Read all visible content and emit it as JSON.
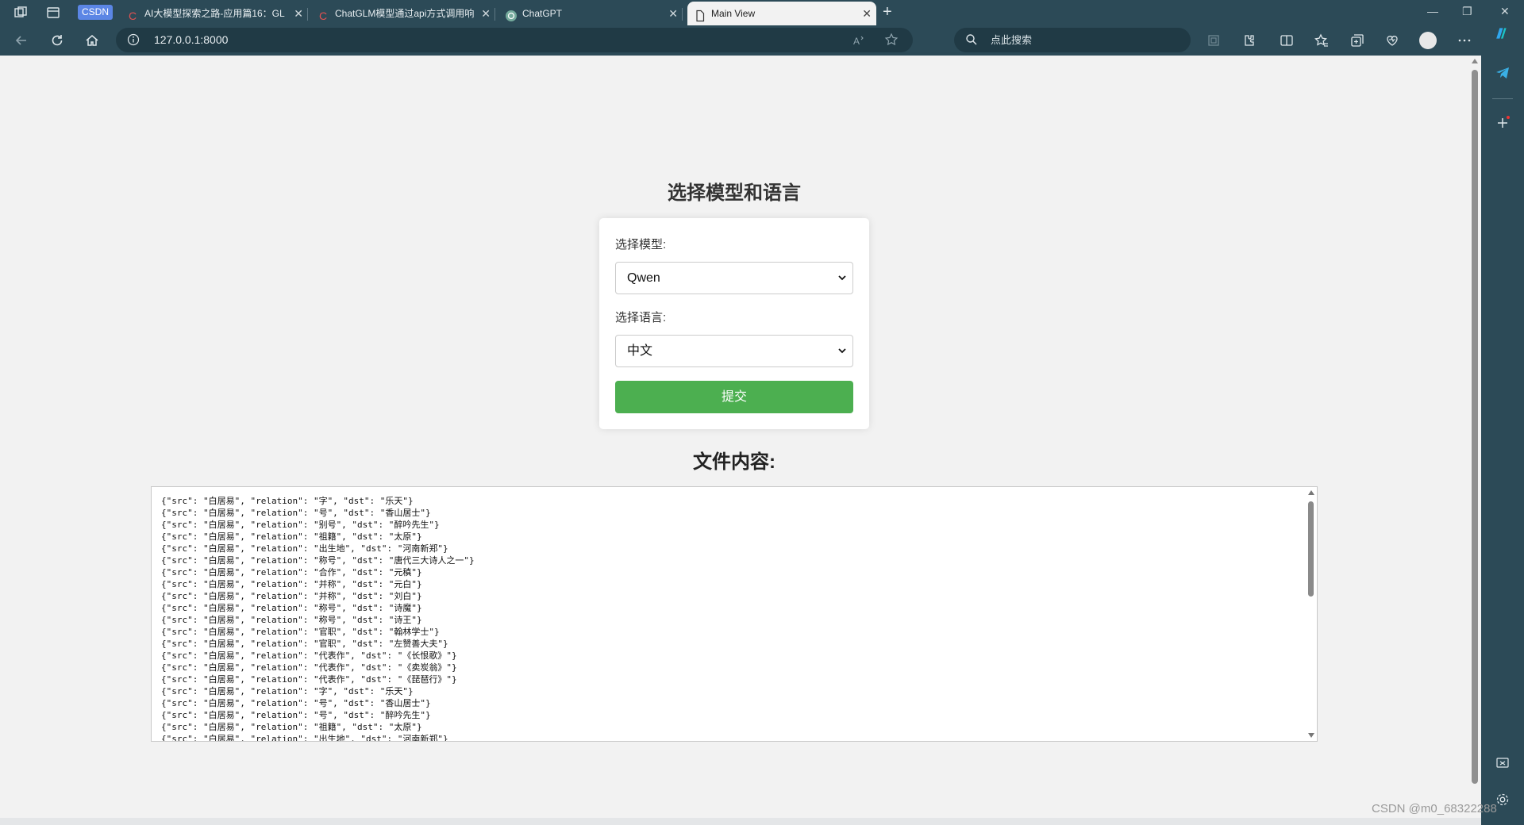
{
  "browser": {
    "tab_group": "CSDN",
    "tabs": [
      {
        "title": "AI大模型探索之路-应用篇16：GL",
        "favicon": "csdn-c-icon"
      },
      {
        "title": "ChatGLM模型通过api方式调用响",
        "favicon": "csdn-c-icon"
      },
      {
        "title": "ChatGPT",
        "favicon": "chatgpt-icon"
      },
      {
        "title": "Main View",
        "favicon": "page-icon"
      }
    ],
    "new_tab": "+",
    "url": "127.0.0.1:8000",
    "search_placeholder": "点此搜索",
    "accent_color": "#2c4a57"
  },
  "page": {
    "title": "选择模型和语言",
    "model_label": "选择模型:",
    "model_selected": "Qwen",
    "language_label": "选择语言:",
    "language_selected": "中文",
    "submit_label": "提交",
    "submit_color": "#4caf50",
    "file_heading": "文件内容:",
    "file_lines": [
      "{\"src\": \"白居易\", \"relation\": \"字\", \"dst\": \"乐天\"}",
      "{\"src\": \"白居易\", \"relation\": \"号\", \"dst\": \"香山居士\"}",
      "{\"src\": \"白居易\", \"relation\": \"别号\", \"dst\": \"醉吟先生\"}",
      "{\"src\": \"白居易\", \"relation\": \"祖籍\", \"dst\": \"太原\"}",
      "{\"src\": \"白居易\", \"relation\": \"出生地\", \"dst\": \"河南新郑\"}",
      "{\"src\": \"白居易\", \"relation\": \"称号\", \"dst\": \"唐代三大诗人之一\"}",
      "{\"src\": \"白居易\", \"relation\": \"合作\", \"dst\": \"元稹\"}",
      "{\"src\": \"白居易\", \"relation\": \"并称\", \"dst\": \"元白\"}",
      "{\"src\": \"白居易\", \"relation\": \"并称\", \"dst\": \"刘白\"}",
      "{\"src\": \"白居易\", \"relation\": \"称号\", \"dst\": \"诗魔\"}",
      "{\"src\": \"白居易\", \"relation\": \"称号\", \"dst\": \"诗王\"}",
      "{\"src\": \"白居易\", \"relation\": \"官职\", \"dst\": \"翰林学士\"}",
      "{\"src\": \"白居易\", \"relation\": \"官职\", \"dst\": \"左赞善大夫\"}",
      "{\"src\": \"白居易\", \"relation\": \"代表作\", \"dst\": \"《长恨歌》\"}",
      "{\"src\": \"白居易\", \"relation\": \"代表作\", \"dst\": \"《卖炭翁》\"}",
      "{\"src\": \"白居易\", \"relation\": \"代表作\", \"dst\": \"《琵琶行》\"}",
      "{\"src\": \"白居易\", \"relation\": \"字\", \"dst\": \"乐天\"}",
      "{\"src\": \"白居易\", \"relation\": \"号\", \"dst\": \"香山居士\"}",
      "{\"src\": \"白居易\", \"relation\": \"号\", \"dst\": \"醉吟先生\"}",
      "{\"src\": \"白居易\", \"relation\": \"祖籍\", \"dst\": \"太原\"}",
      "{\"src\": \"白居易\", \"relation\": \"出生地\", \"dst\": \"河南新郑\"}"
    ]
  },
  "watermark": "CSDN @m0_68322288"
}
